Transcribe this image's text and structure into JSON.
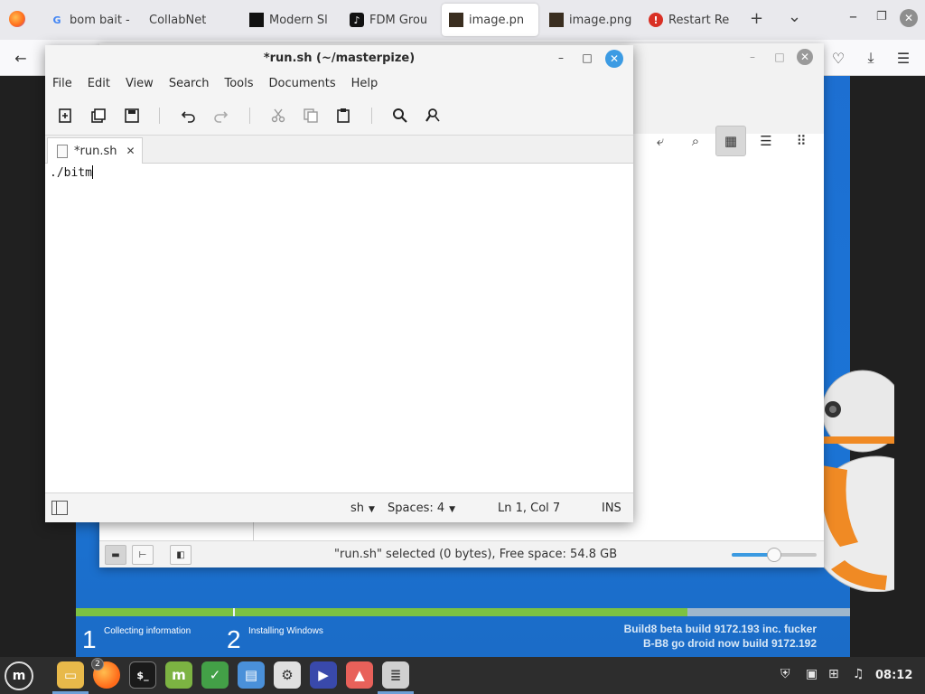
{
  "browser": {
    "tabs": [
      {
        "label": "bom bait -",
        "favicon": "G"
      },
      {
        "label": "CollabNet",
        "favicon": ""
      },
      {
        "label": "Modern Sl",
        "favicon": ""
      },
      {
        "label": "FDM Grou",
        "favicon": "♪"
      },
      {
        "label": "image.pn",
        "favicon": ""
      },
      {
        "label": "image.png",
        "favicon": ""
      },
      {
        "label": "Restart Re",
        "favicon": "!"
      }
    ],
    "new_tab_symbol": "+",
    "list_tabs_symbol": "⌄"
  },
  "installer": {
    "steps": [
      {
        "number": "1",
        "label": "Collecting information"
      },
      {
        "number": "2",
        "label": "Installing Windows"
      }
    ],
    "build_lines": [
      "Build8 beta build 9172.193 inc. fucker",
      "B-B8 go droid now build 9172.192"
    ],
    "progress_fraction": 0.79
  },
  "file_manager": {
    "status_text": "\"run.sh\" selected (0 bytes), Free space: 54.8 GB",
    "zoom_fraction": 0.5
  },
  "editor": {
    "title": "*run.sh (~/masterpize)",
    "menu": [
      "File",
      "Edit",
      "View",
      "Search",
      "Tools",
      "Documents",
      "Help"
    ],
    "tab_label": "*run.sh",
    "content": "./bitm",
    "status": {
      "language": "sh",
      "spaces": "Spaces: 4",
      "position": "Ln 1, Col 7",
      "mode": "INS"
    }
  },
  "taskbar": {
    "firefox_badge": "2",
    "clock": "08:12"
  },
  "colors": {
    "accent_blue": "#3c9be3",
    "installer_blue": "#1d6fd1",
    "progress_green": "#7cc242"
  }
}
